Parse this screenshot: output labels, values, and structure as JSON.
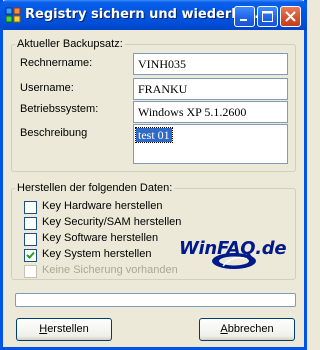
{
  "window": {
    "title": "Registry sichern und wiederhe..."
  },
  "backup": {
    "group_title": "Aktueller Backupsatz:",
    "computer_label": "Rechnername:",
    "computer_value": "VINH035",
    "user_label": "Username:",
    "user_value": "FRANKU",
    "os_label": "Betriebssystem:",
    "os_value": "Windows XP 5.1.2600",
    "desc_label": "Beschreibung",
    "desc_value": "test 01"
  },
  "create": {
    "group_title": "Herstellen der folgenden Daten:",
    "options": [
      {
        "label": "Key Hardware herstellen",
        "checked": false,
        "enabled": true
      },
      {
        "label": "Key Security/SAM herstellen",
        "checked": false,
        "enabled": true
      },
      {
        "label": "Key Software herstellen",
        "checked": false,
        "enabled": true
      },
      {
        "label": "Key System herstellen",
        "checked": true,
        "enabled": true
      },
      {
        "label": "Keine Sicherung vorhanden",
        "checked": false,
        "enabled": false
      }
    ]
  },
  "logo": {
    "text": "WinFAQ.de"
  },
  "progress": {
    "value": 0
  },
  "buttons": {
    "create_first": "H",
    "create_rest": "erstellen",
    "cancel_first": "A",
    "cancel_rest": "bbrechen"
  },
  "colors": {
    "titlebar": "#0055e5",
    "window_bg": "#ece9d8",
    "selection": "#316ac5",
    "logo": "#001a8c"
  }
}
